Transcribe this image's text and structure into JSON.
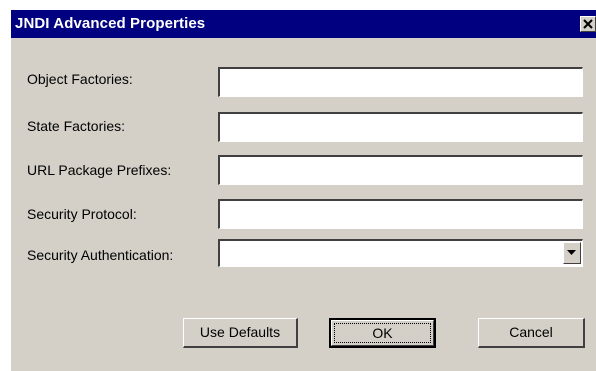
{
  "dialog": {
    "title": "JNDI Advanced Properties",
    "colors": {
      "titlebar": "#000080",
      "face": "#d4d0c8"
    }
  },
  "fields": {
    "object_factories": {
      "label": "Object Factories:",
      "value": ""
    },
    "state_factories": {
      "label": "State Factories:",
      "value": ""
    },
    "url_package_prefixes": {
      "label": "URL Package Prefixes:",
      "value": ""
    },
    "security_protocol": {
      "label": "Security Protocol:",
      "value": ""
    },
    "security_authentication": {
      "label": "Security Authentication:",
      "value": ""
    }
  },
  "buttons": {
    "use_defaults": "Use Defaults",
    "ok": "OK",
    "cancel": "Cancel"
  },
  "icons": {
    "close": "close-icon",
    "dropdown": "chevron-down-icon"
  }
}
